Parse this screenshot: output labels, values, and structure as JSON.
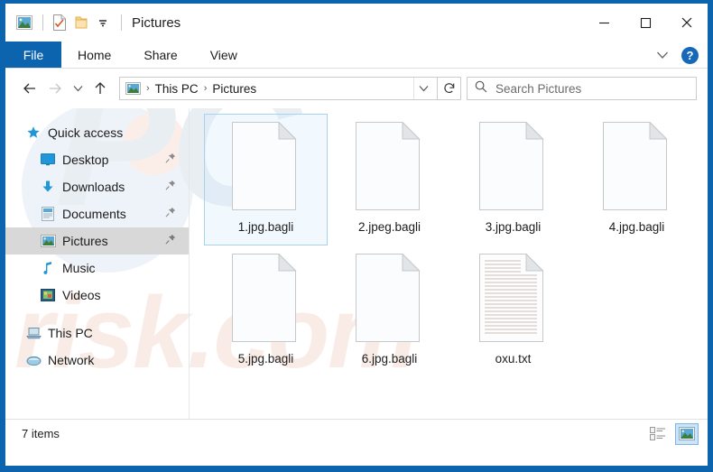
{
  "window": {
    "title": "Pictures",
    "quick_access_icons": [
      "picture-icon",
      "properties-icon",
      "new-folder-icon",
      "customize-dropdown-icon"
    ],
    "controls": {
      "minimize": "–",
      "maximize": "☐",
      "close": "✕"
    },
    "border_color": "#0b64ad"
  },
  "ribbon": {
    "tabs": [
      {
        "label": "File",
        "id": "file",
        "active": true
      },
      {
        "label": "Home",
        "id": "home",
        "active": false
      },
      {
        "label": "Share",
        "id": "share",
        "active": false
      },
      {
        "label": "View",
        "id": "view",
        "active": false
      }
    ],
    "collapse_icon": "chevron-down-icon",
    "help_label": "?",
    "accent_color": "#0b64ad"
  },
  "address_bar": {
    "back_icon": "back-arrow-icon",
    "forward_icon": "forward-arrow-icon",
    "recent_icon": "chevron-down-icon",
    "up_icon": "up-arrow-icon",
    "breadcrumb": [
      {
        "label": "This PC"
      },
      {
        "label": "Pictures"
      }
    ],
    "separator": "›",
    "dropdown_icon": "chevron-down-icon",
    "refresh_icon": "refresh-icon"
  },
  "search": {
    "placeholder": "Search Pictures",
    "value": "",
    "icon": "search-icon"
  },
  "sidebar": {
    "items": [
      {
        "label": "Quick access",
        "icon": "star-icon",
        "indent": false,
        "pinned": false,
        "selected": false
      },
      {
        "label": "Desktop",
        "icon": "desktop-icon",
        "indent": true,
        "pinned": true,
        "selected": false
      },
      {
        "label": "Downloads",
        "icon": "downloads-icon",
        "indent": true,
        "pinned": true,
        "selected": false
      },
      {
        "label": "Documents",
        "icon": "documents-icon",
        "indent": true,
        "pinned": true,
        "selected": false
      },
      {
        "label": "Pictures",
        "icon": "pictures-icon",
        "indent": true,
        "pinned": true,
        "selected": true
      },
      {
        "label": "Music",
        "icon": "music-icon",
        "indent": true,
        "pinned": false,
        "selected": false
      },
      {
        "label": "Videos",
        "icon": "videos-icon",
        "indent": true,
        "pinned": false,
        "selected": false
      },
      {
        "label": "This PC",
        "icon": "this-pc-icon",
        "indent": false,
        "pinned": false,
        "selected": false
      },
      {
        "label": "Network",
        "icon": "network-icon",
        "indent": false,
        "pinned": false,
        "selected": false
      }
    ]
  },
  "files": [
    {
      "name": "1.jpg.bagli",
      "icon": "blank-file-icon",
      "selected": true
    },
    {
      "name": "2.jpeg.bagli",
      "icon": "blank-file-icon",
      "selected": false
    },
    {
      "name": "3.jpg.bagli",
      "icon": "blank-file-icon",
      "selected": false
    },
    {
      "name": "4.jpg.bagli",
      "icon": "blank-file-icon",
      "selected": false
    },
    {
      "name": "5.jpg.bagli",
      "icon": "blank-file-icon",
      "selected": false
    },
    {
      "name": "6.jpg.bagli",
      "icon": "blank-file-icon",
      "selected": false
    },
    {
      "name": "oxu.txt",
      "icon": "text-file-icon",
      "selected": false
    }
  ],
  "status_bar": {
    "item_count": "7 items",
    "views": [
      {
        "id": "details",
        "icon": "details-view-icon",
        "active": false
      },
      {
        "id": "large-icons",
        "icon": "large-icons-view-icon",
        "active": true
      }
    ]
  },
  "watermark": {
    "line1": "PC",
    "line2": "risk.com"
  }
}
